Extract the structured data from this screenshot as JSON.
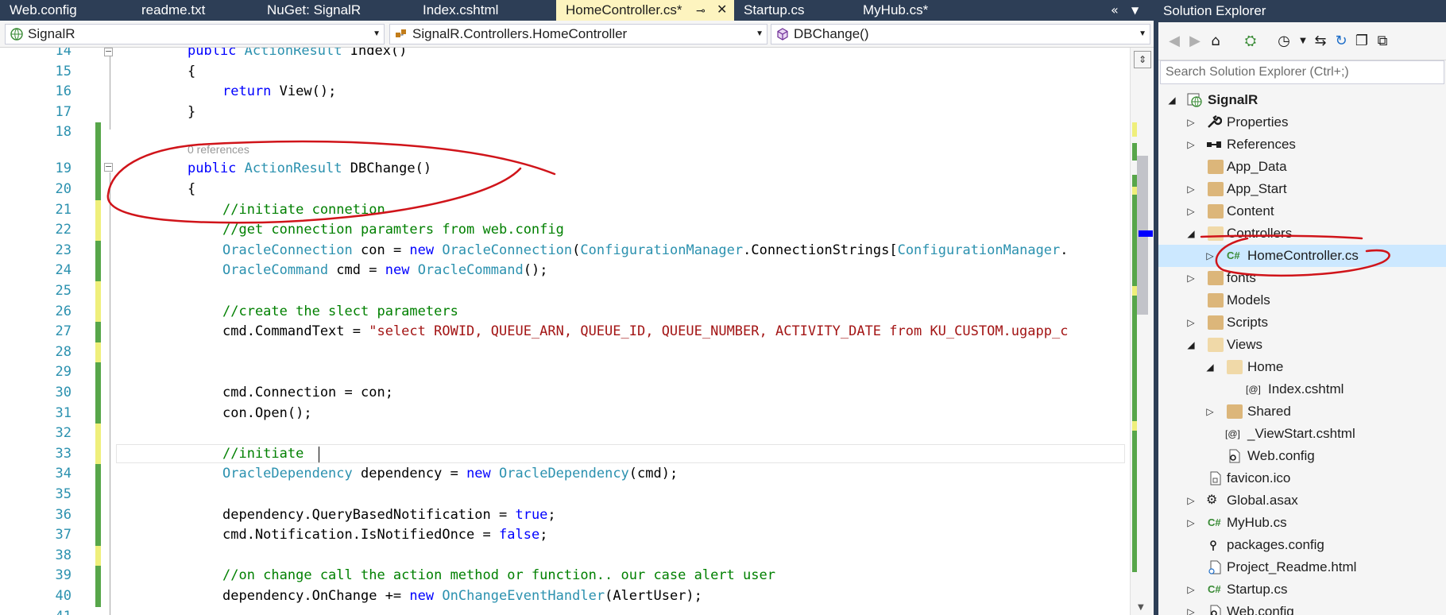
{
  "tabs": [
    {
      "label": "Web.config",
      "active": false
    },
    {
      "label": "readme.txt",
      "active": false
    },
    {
      "label": "NuGet: SignalR",
      "active": false
    },
    {
      "label": "Index.cshtml",
      "active": false
    },
    {
      "label": "HomeController.cs*",
      "active": true
    },
    {
      "label": "Startup.cs",
      "active": false
    },
    {
      "label": "MyHub.cs*",
      "active": false
    }
  ],
  "tab_controls": {
    "overflow": "«",
    "close": "✕",
    "pin": "⊸"
  },
  "nav": {
    "project": "SignalR",
    "class": "SignalR.Controllers.HomeController",
    "member": "DBChange()"
  },
  "editor": {
    "codelens": "0 references",
    "lines": [
      {
        "n": "14",
        "change": "none"
      },
      {
        "n": "15",
        "change": "none"
      },
      {
        "n": "16",
        "change": "none"
      },
      {
        "n": "17",
        "change": "none"
      },
      {
        "n": "18",
        "change": "green"
      },
      {
        "n": "19",
        "change": "green"
      },
      {
        "n": "20",
        "change": "green"
      },
      {
        "n": "21",
        "change": "yellow"
      },
      {
        "n": "22",
        "change": "yellow"
      },
      {
        "n": "23",
        "change": "green"
      },
      {
        "n": "24",
        "change": "green"
      },
      {
        "n": "25",
        "change": "yellow"
      },
      {
        "n": "26",
        "change": "yellow"
      },
      {
        "n": "27",
        "change": "green"
      },
      {
        "n": "28",
        "change": "yellow"
      },
      {
        "n": "29",
        "change": "green"
      },
      {
        "n": "30",
        "change": "green"
      },
      {
        "n": "31",
        "change": "green"
      },
      {
        "n": "32",
        "change": "yellow"
      },
      {
        "n": "33",
        "change": "yellow"
      },
      {
        "n": "34",
        "change": "green"
      },
      {
        "n": "35",
        "change": "green"
      },
      {
        "n": "36",
        "change": "green"
      },
      {
        "n": "37",
        "change": "green"
      },
      {
        "n": "38",
        "change": "yellow"
      },
      {
        "n": "39",
        "change": "green"
      },
      {
        "n": "40",
        "change": "green"
      },
      {
        "n": "41",
        "change": "none"
      }
    ],
    "code": {
      "l14": [
        "public",
        "ActionResult",
        "Index()"
      ],
      "l15": "{",
      "l16": [
        "return",
        "View();"
      ],
      "l17": "}",
      "l19": [
        "public",
        "ActionResult",
        "DBChange()"
      ],
      "l20": "{",
      "l21": "//initiate connetion",
      "l22": "//get connection paramters from web.config",
      "l23": [
        "OracleConnection",
        " con = ",
        "new",
        "OracleConnection",
        "(",
        "ConfigurationManager",
        ".ConnectionStrings[",
        "ConfigurationManager",
        "."
      ],
      "l24": [
        "OracleCommand",
        " cmd = ",
        "new",
        "OracleCommand",
        "();"
      ],
      "l26": "//create the slect parameters",
      "l27": [
        "cmd.CommandText = ",
        "\"select ROWID, QUEUE_ARN, QUEUE_ID, QUEUE_NUMBER, ACTIVITY_DATE from KU_CUSTOM.ugapp_c"
      ],
      "l30": "cmd.Connection = con;",
      "l31": "con.Open();",
      "l33": "//initiate ",
      "l34": [
        "OracleDependency",
        " dependency = ",
        "new",
        "OracleDependency",
        "(cmd);"
      ],
      "l36": [
        "dependency.QueryBasedNotification = ",
        "true",
        ";"
      ],
      "l37": [
        "cmd.Notification.IsNotifiedOnce = ",
        "false",
        ";"
      ],
      "l39": "//on change call the action method or function.. our case alert user",
      "l40": [
        "dependency.OnChange += ",
        "new",
        "OnChangeEventHandler",
        "(AlertUser);"
      ]
    }
  },
  "solution_explorer": {
    "title": "Solution Explorer",
    "search_placeholder": "Search Solution Explorer (Ctrl+;)",
    "tree": [
      {
        "label": "SignalR",
        "depth": 0,
        "expander": "open",
        "icon": "project-icon",
        "bold": true
      },
      {
        "label": "Properties",
        "depth": 1,
        "expander": "closed",
        "icon": "wrench-icon"
      },
      {
        "label": "References",
        "depth": 1,
        "expander": "closed",
        "icon": "references-icon"
      },
      {
        "label": "App_Data",
        "depth": 1,
        "expander": "none",
        "icon": "folder-icon"
      },
      {
        "label": "App_Start",
        "depth": 1,
        "expander": "closed",
        "icon": "folder-icon"
      },
      {
        "label": "Content",
        "depth": 1,
        "expander": "closed",
        "icon": "folder-icon"
      },
      {
        "label": "Controllers",
        "depth": 1,
        "expander": "open",
        "icon": "folder-open-icon"
      },
      {
        "label": "HomeController.cs",
        "depth": 2,
        "expander": "closed",
        "icon": "csharp-icon",
        "selected": true
      },
      {
        "label": "fonts",
        "depth": 1,
        "expander": "closed",
        "icon": "folder-icon"
      },
      {
        "label": "Models",
        "depth": 1,
        "expander": "none",
        "icon": "folder-icon"
      },
      {
        "label": "Scripts",
        "depth": 1,
        "expander": "closed",
        "icon": "folder-icon"
      },
      {
        "label": "Views",
        "depth": 1,
        "expander": "open",
        "icon": "folder-open-icon"
      },
      {
        "label": "Home",
        "depth": 2,
        "expander": "open",
        "icon": "folder-open-icon"
      },
      {
        "label": "Index.cshtml",
        "depth": 3,
        "expander": "none",
        "icon": "razor-icon"
      },
      {
        "label": "Shared",
        "depth": 2,
        "expander": "closed",
        "icon": "folder-icon"
      },
      {
        "label": "_ViewStart.cshtml",
        "depth": 2,
        "expander": "none",
        "icon": "razor-icon"
      },
      {
        "label": "Web.config",
        "depth": 2,
        "expander": "none",
        "icon": "config-icon"
      },
      {
        "label": "favicon.ico",
        "depth": 1,
        "expander": "none",
        "icon": "image-icon"
      },
      {
        "label": "Global.asax",
        "depth": 1,
        "expander": "closed",
        "icon": "gear-icon"
      },
      {
        "label": "MyHub.cs",
        "depth": 1,
        "expander": "closed",
        "icon": "csharp-icon"
      },
      {
        "label": "packages.config",
        "depth": 1,
        "expander": "none",
        "icon": "package-icon"
      },
      {
        "label": "Project_Readme.html",
        "depth": 1,
        "expander": "none",
        "icon": "html-icon"
      },
      {
        "label": "Startup.cs",
        "depth": 1,
        "expander": "closed",
        "icon": "csharp-icon"
      },
      {
        "label": "Web.config",
        "depth": 1,
        "expander": "closed",
        "icon": "config-icon"
      }
    ]
  },
  "colors": {
    "chrome": "#2d3e56",
    "active_tab": "#fdf4bf",
    "keyword": "#0000ff",
    "type": "#2b91af",
    "comment": "#008000",
    "string": "#a31515",
    "annotation": "#d0141a",
    "selection": "#cce8ff"
  }
}
